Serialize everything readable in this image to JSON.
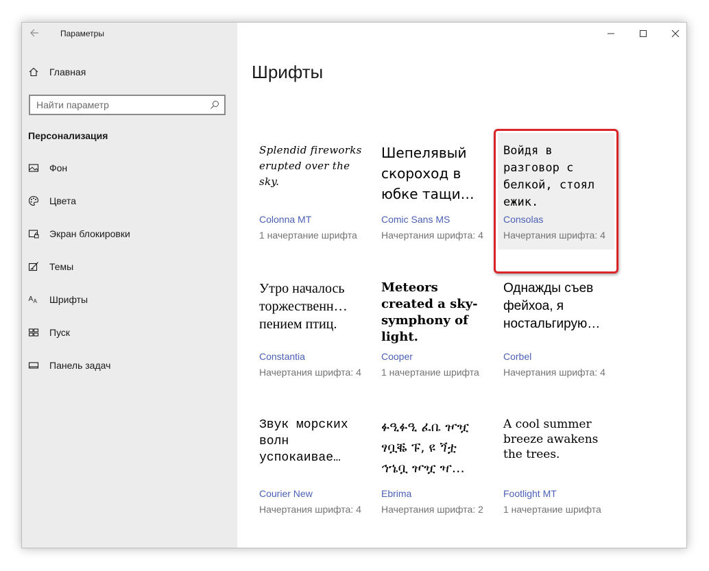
{
  "window": {
    "title": "Параметры"
  },
  "sidebar": {
    "home_label": "Главная",
    "search_placeholder": "Найти параметр",
    "section_title": "Персонализация",
    "items": [
      {
        "label": "Фон",
        "icon": "image-icon"
      },
      {
        "label": "Цвета",
        "icon": "palette-icon"
      },
      {
        "label": "Экран блокировки",
        "icon": "lock-screen-icon"
      },
      {
        "label": "Темы",
        "icon": "themes-icon"
      },
      {
        "label": "Шрифты",
        "icon": "fonts-icon"
      },
      {
        "label": "Пуск",
        "icon": "start-icon"
      },
      {
        "label": "Панель задач",
        "icon": "taskbar-icon"
      }
    ]
  },
  "main": {
    "title": "Шрифты",
    "fonts": [
      {
        "sample": "Splendid fireworks erupted over the sky.",
        "name": "Colonna MT",
        "count": "1 начертание шрифта"
      },
      {
        "sample": "Шепелявый скороход в юбке тащи…",
        "name": "Comic Sans MS",
        "count": "Начертания шрифта: 4"
      },
      {
        "sample": "Войдя в разговор с белкой, стоял ежик.",
        "name": "Consolas",
        "count": "Начертания шрифта: 4"
      },
      {
        "sample": "Утро началось торжественн… пением птиц.",
        "name": "Constantia",
        "count": "Начертания шрифта: 4"
      },
      {
        "sample": "Meteors created a sky-symphony of light.",
        "name": "Cooper",
        "count": "1 начертание шрифта"
      },
      {
        "sample": "Однажды съев фейхоа, я ностальгирую…",
        "name": "Corbel",
        "count": "Начертания шрифта: 4"
      },
      {
        "sample": "Звук морских волн успокаивае…",
        "name": "Courier New",
        "count": "Начертания шрифта: 4"
      },
      {
        "sample": "ፉዒፉዒ ፈቤ ዦዧ ፃቧቘ ፑ, ዩ ጘቷ ኅኄቧ ዦዧ ዣ…",
        "name": "Ebrima",
        "count": "Начертания шрифта: 2"
      },
      {
        "sample": "A cool summer breeze awakens the trees.",
        "name": "Footlight MT",
        "count": "1 начертание шрифта"
      }
    ]
  },
  "colors": {
    "highlight_frame": "#d9252a",
    "font_name_link": "#4a5fb5",
    "sidebar_bg": "#ececec"
  }
}
